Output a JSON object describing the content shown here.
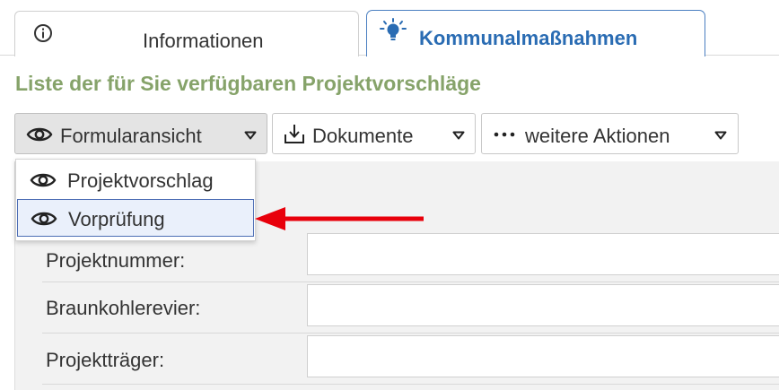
{
  "tabs": [
    {
      "label": "Informationen",
      "icon": "info-icon",
      "active": false
    },
    {
      "label": "Kommunalmaßnahmen",
      "icon": "lightbulb-icon",
      "active": true
    }
  ],
  "list_title": "Liste der für Sie verfügbaren Projektvorschläge",
  "toolbar": {
    "form_view_label": "Formularansicht",
    "documents_label": "Dokumente",
    "more_actions_label": "weitere Aktionen"
  },
  "dropdown": {
    "items": [
      {
        "label": "Projektvorschlag",
        "icon": "eye-icon",
        "highlighted": false
      },
      {
        "label": "Vorprüfung",
        "icon": "eye-icon",
        "highlighted": true
      }
    ]
  },
  "form": {
    "fields": [
      {
        "label": "Projektnummer:",
        "value": ""
      },
      {
        "label": "Braunkohlerevier:",
        "value": ""
      },
      {
        "label": "Projektträger:",
        "value": ""
      }
    ]
  },
  "colors": {
    "accent": "#2a6cb3",
    "title_green": "#86a36a",
    "annotation_arrow": "#e8000b"
  }
}
